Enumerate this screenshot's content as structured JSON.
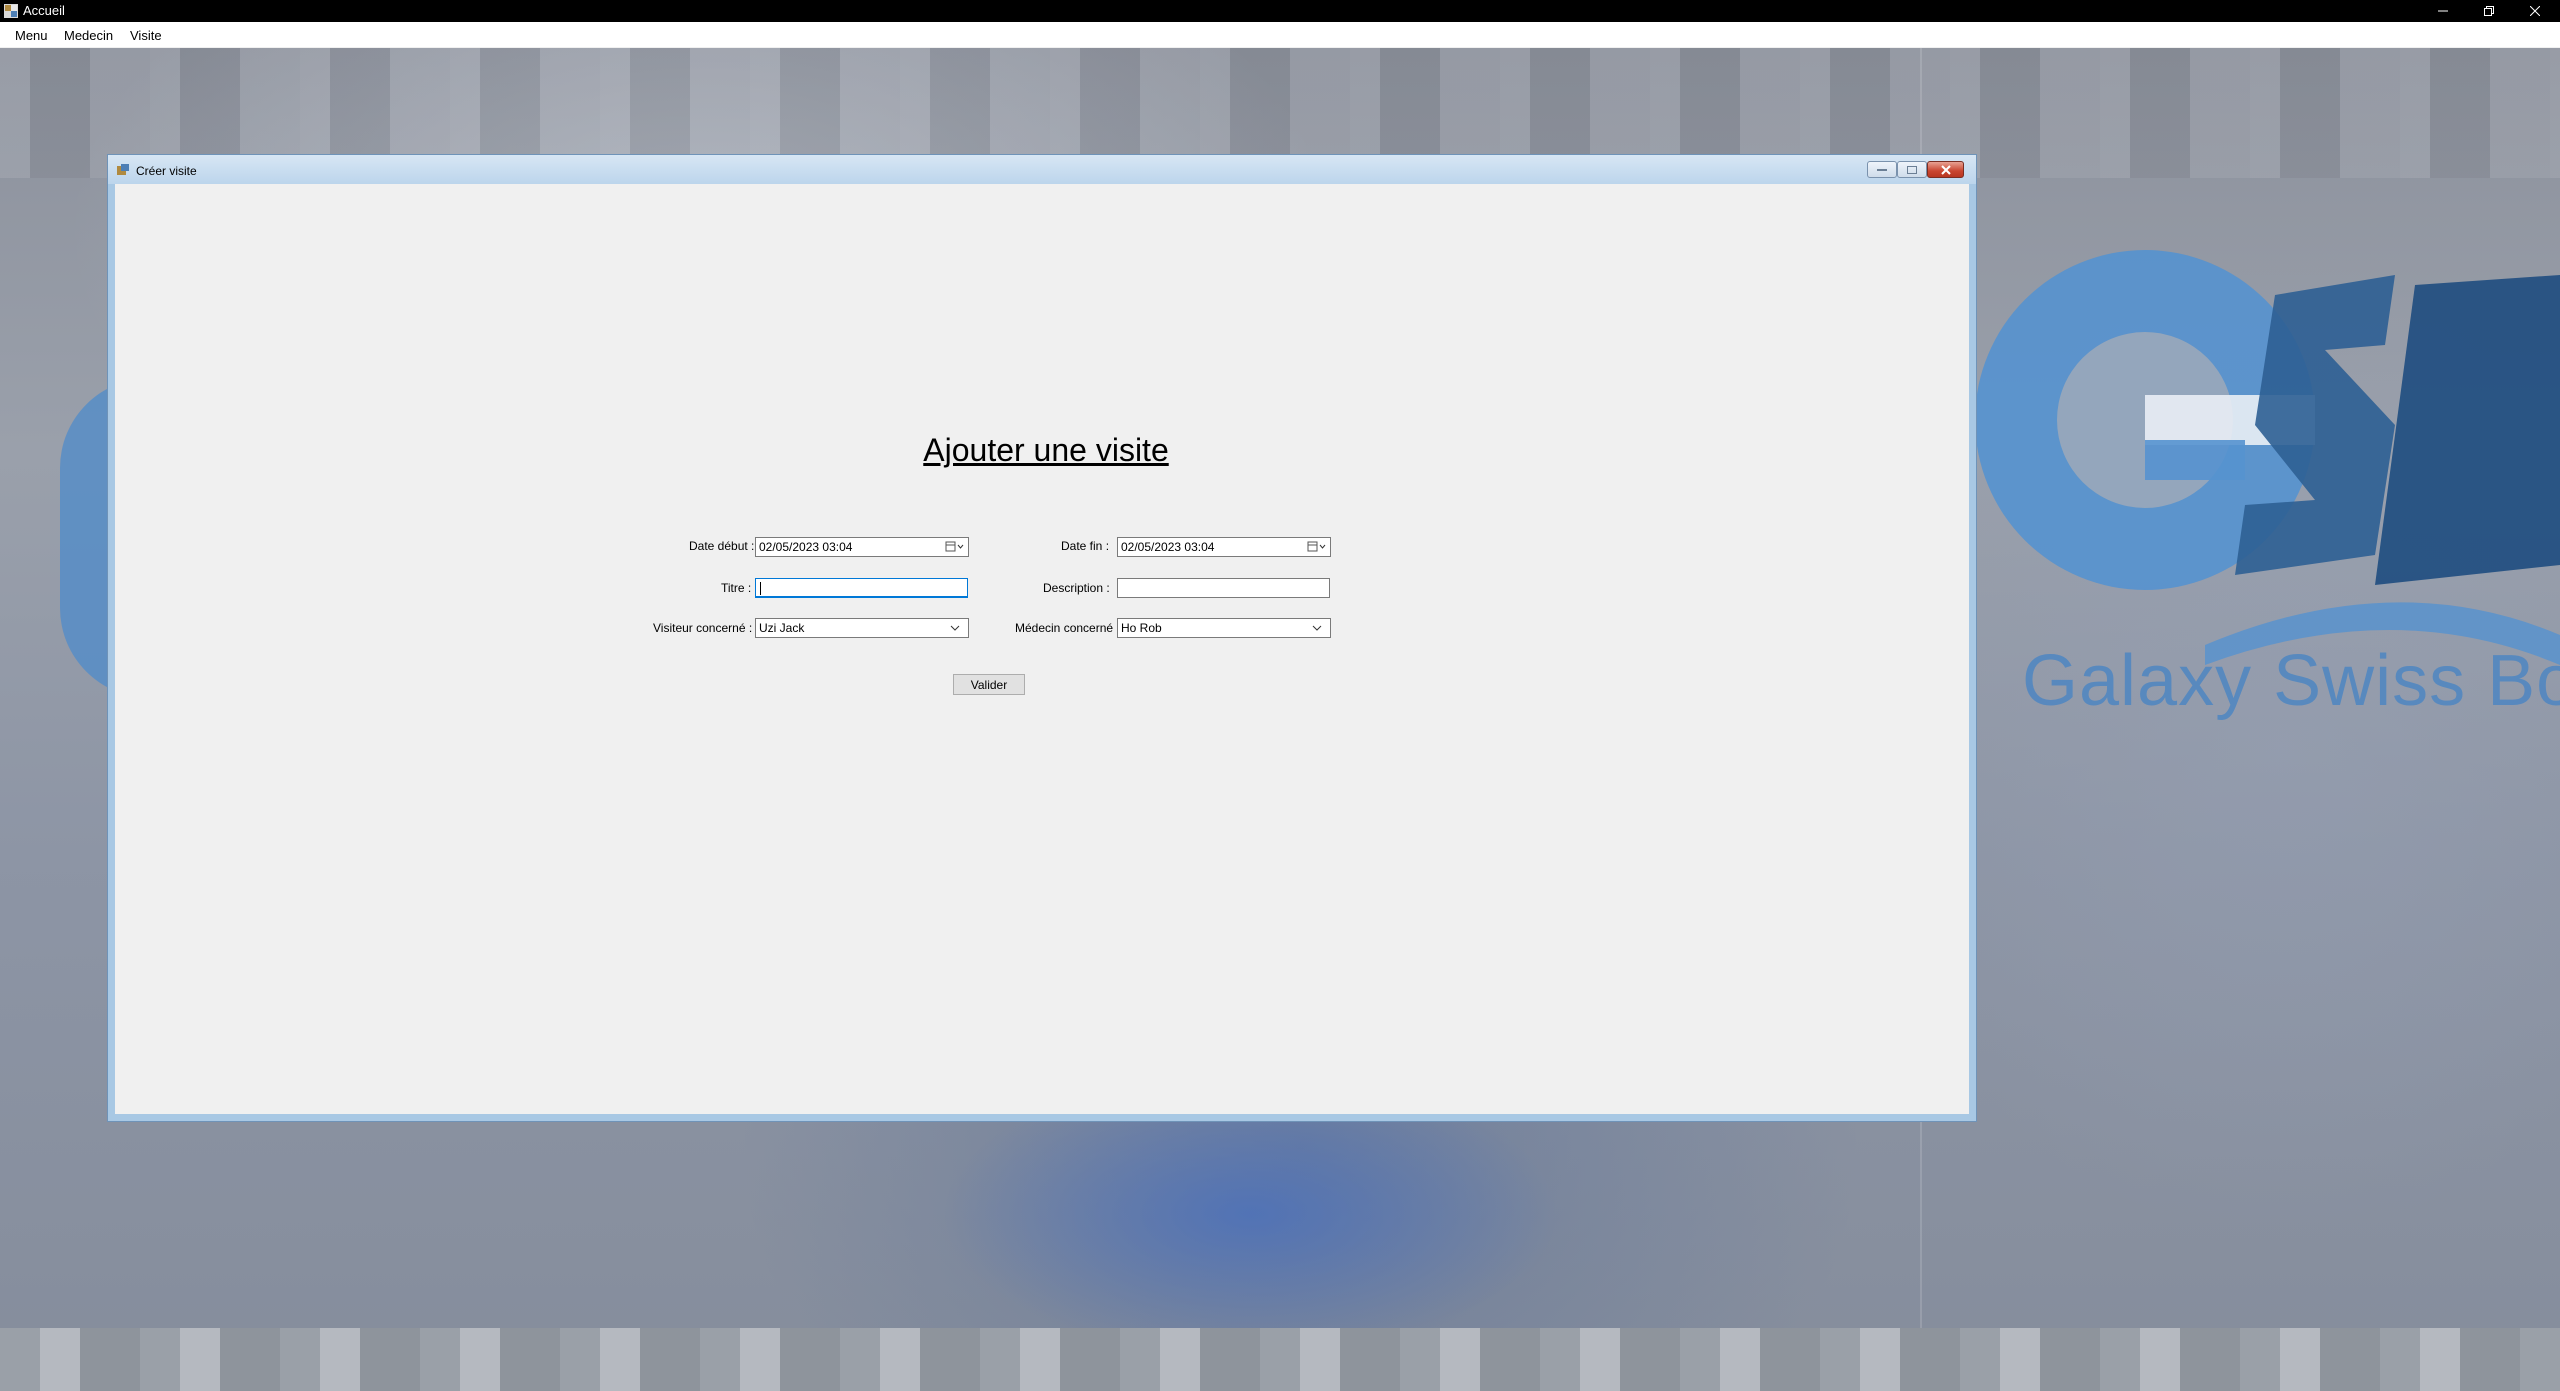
{
  "window": {
    "title": "Accueil",
    "controls": [
      "minimize-icon",
      "restore-icon",
      "close-icon"
    ]
  },
  "menu": {
    "items": [
      "Menu",
      "Medecin",
      "Visite"
    ]
  },
  "background": {
    "logo_tagline": "Galaxy Swiss Bour",
    "logo_letters": "GSB",
    "brand_color": "#3f7fbf"
  },
  "form": {
    "title": "Créer visite",
    "heading": "Ajouter une visite",
    "date_debut": {
      "label": "Date début :",
      "value": "02/05/2023 03:04"
    },
    "date_fin": {
      "label": "Date fin :",
      "value": "02/05/2023 03:04"
    },
    "titre": {
      "label": "Titre :",
      "value": ""
    },
    "description": {
      "label": "Description :",
      "value": ""
    },
    "visiteur": {
      "label": "Visiteur concerné :",
      "selected": "Uzi Jack"
    },
    "medecin": {
      "label": "Médecin concerné :",
      "selected": "Ho Rob"
    },
    "submit_label": "Valider"
  }
}
